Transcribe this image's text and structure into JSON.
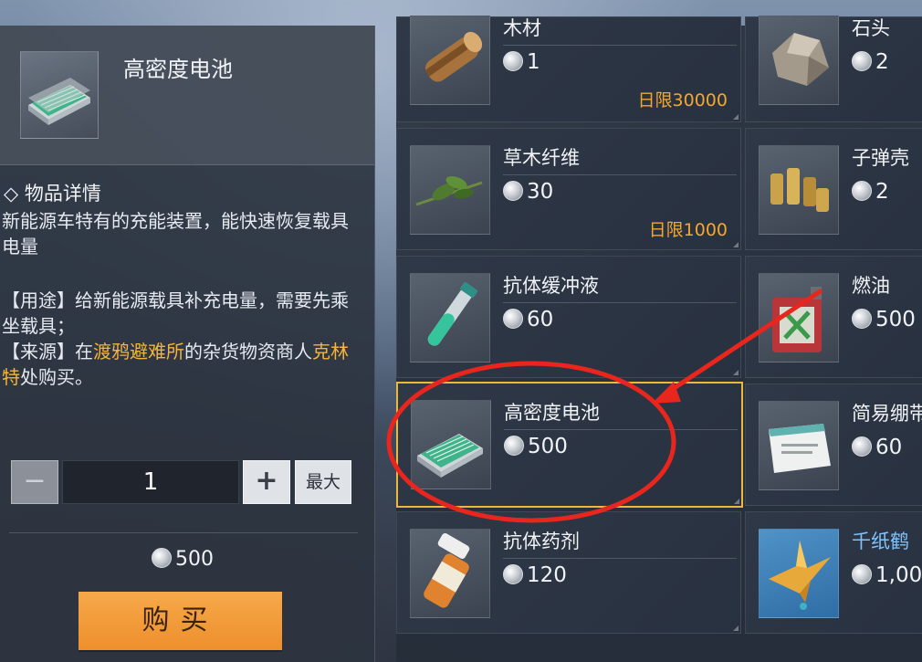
{
  "selected_item": {
    "name": "高密度电池",
    "detail_heading": "◇ 物品详情",
    "description": "新能源车特有的充能装置，能快速恢复载具电量",
    "usage_prefix": "【用途】给新能源载具补充电量，需要先乘坐载具；",
    "source_prefix": "【来源】在",
    "source_place": "渡鸦避难所",
    "source_mid": "的杂货物资商人",
    "source_npc": "克林特",
    "source_suffix": "处购买。"
  },
  "quantity": {
    "minus_label": "−",
    "value": "1",
    "plus_label": "+",
    "max_label": "最大"
  },
  "total_price": "500",
  "buy_label": "购买",
  "items": [
    {
      "name": "木材",
      "price": "1",
      "limit": "日限30000",
      "icon": "wood-log-icon"
    },
    {
      "name": "石头",
      "price": "2",
      "limit": "",
      "icon": "stone-icon"
    },
    {
      "name": "草木纤维",
      "price": "30",
      "limit": "日限1000",
      "icon": "plant-fiber-icon"
    },
    {
      "name": "子弹壳",
      "price": "2",
      "limit": "",
      "icon": "bullet-casing-icon"
    },
    {
      "name": "抗体缓冲液",
      "price": "60",
      "limit": "",
      "icon": "test-tube-icon"
    },
    {
      "name": "燃油",
      "price": "500",
      "limit": "",
      "icon": "fuel-can-icon"
    },
    {
      "name": "高密度电池",
      "price": "500",
      "limit": "",
      "icon": "battery-icon",
      "selected": true
    },
    {
      "name": "简易绷带",
      "price": "60",
      "limit": "",
      "icon": "bandage-icon"
    },
    {
      "name": "抗体药剂",
      "price": "120",
      "limit": "",
      "icon": "pill-bottle-icon"
    },
    {
      "name": "千纸鹤",
      "price": "1,00",
      "limit": "",
      "icon": "paper-crane-icon",
      "rare": true
    }
  ],
  "colors": {
    "accent_orange": "#f4a72e",
    "selection_border": "#e8b93a",
    "annotation_red": "#e8261e",
    "rare_blue": "#7fc4ff"
  }
}
